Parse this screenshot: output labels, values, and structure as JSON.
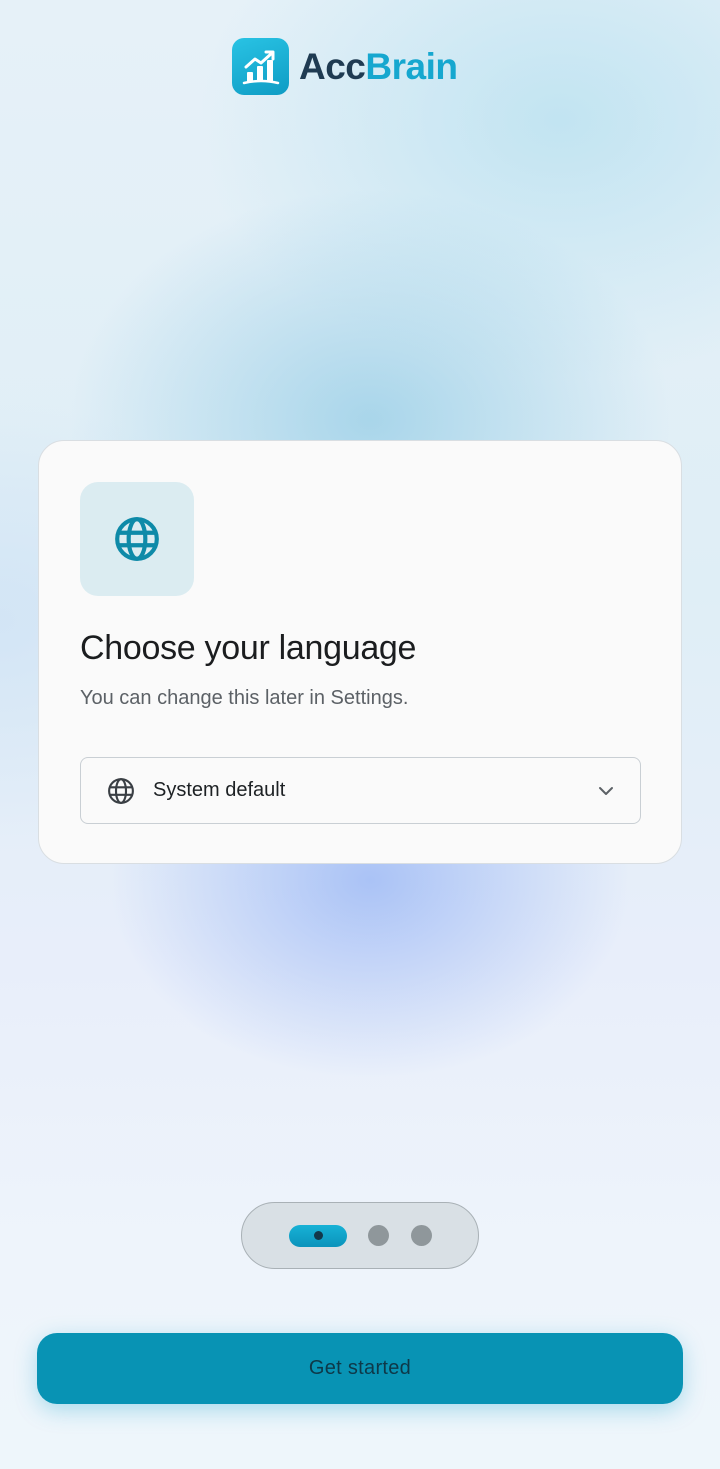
{
  "brand": {
    "name_part1": "Acc",
    "name_part2": "Brain",
    "logo_icon": "bar-chart-growth-icon",
    "accent_color": "#16a7cf"
  },
  "card": {
    "icon": "globe-icon",
    "title": "Choose your language",
    "subtitle": "You can change this later in Settings.",
    "language_select": {
      "icon": "globe-icon",
      "value": "System default",
      "chevron": "chevron-down-icon"
    }
  },
  "pager": {
    "total_pages": 3,
    "current_page": 1
  },
  "cta": {
    "label": "Get started",
    "color": "#0893b4"
  }
}
